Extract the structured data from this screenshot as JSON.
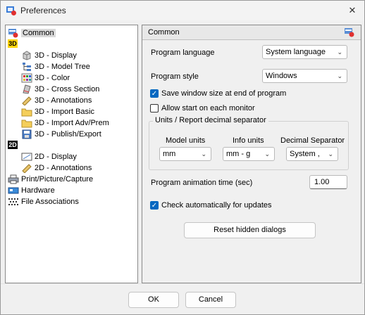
{
  "window": {
    "title": "Preferences"
  },
  "tree": {
    "items": [
      {
        "label": "Common",
        "icon": "common-settings-icon"
      },
      {
        "label": "3D",
        "icon": "badge-3d"
      },
      {
        "label": "3D - Display",
        "icon": "cube-icon"
      },
      {
        "label": "3D - Model Tree",
        "icon": "tree-icon"
      },
      {
        "label": "3D - Color",
        "icon": "color-grid-icon"
      },
      {
        "label": "3D - Cross Section",
        "icon": "cross-section-icon"
      },
      {
        "label": "3D - Annotations",
        "icon": "ruler-icon"
      },
      {
        "label": "3D - Import Basic",
        "icon": "folder-icon"
      },
      {
        "label": "3D - Import Adv/Prem",
        "icon": "folder-icon"
      },
      {
        "label": "3D - Publish/Export",
        "icon": "save-icon"
      },
      {
        "label": "2D",
        "icon": "badge-2d"
      },
      {
        "label": "2D - Display",
        "icon": "display-icon"
      },
      {
        "label": "2D - Annotations",
        "icon": "ruler-icon"
      },
      {
        "label": "Print/Picture/Capture",
        "icon": "printer-icon"
      },
      {
        "label": "Hardware",
        "icon": "hardware-icon"
      },
      {
        "label": "File Associations",
        "icon": "file-assoc-icon"
      }
    ]
  },
  "panel": {
    "title": "Common",
    "program_language": {
      "label": "Program language",
      "value": "System language"
    },
    "program_style": {
      "label": "Program style",
      "value": "Windows"
    },
    "save_window_size": {
      "label": "Save window size at end of program",
      "checked": true
    },
    "allow_start_each_monitor": {
      "label": "Allow start on each monitor",
      "checked": false
    },
    "units_group": {
      "title": "Units / Report decimal separator",
      "model_units": {
        "label": "Model units",
        "value": "mm"
      },
      "info_units": {
        "label": "Info units",
        "value": "mm - g"
      },
      "decimal_separator": {
        "label": "Decimal Separator",
        "value": "System ,"
      }
    },
    "animation_time": {
      "label": "Program animation time (sec)",
      "value": "1.00"
    },
    "check_updates": {
      "label": "Check automatically for updates",
      "checked": true
    },
    "reset_hidden_dialogs": "Reset hidden dialogs"
  },
  "footer": {
    "ok": "OK",
    "cancel": "Cancel"
  },
  "colors": {
    "accent": "#0067c0",
    "badge_3d": "#ffd400",
    "badge_2d": "#000000"
  }
}
